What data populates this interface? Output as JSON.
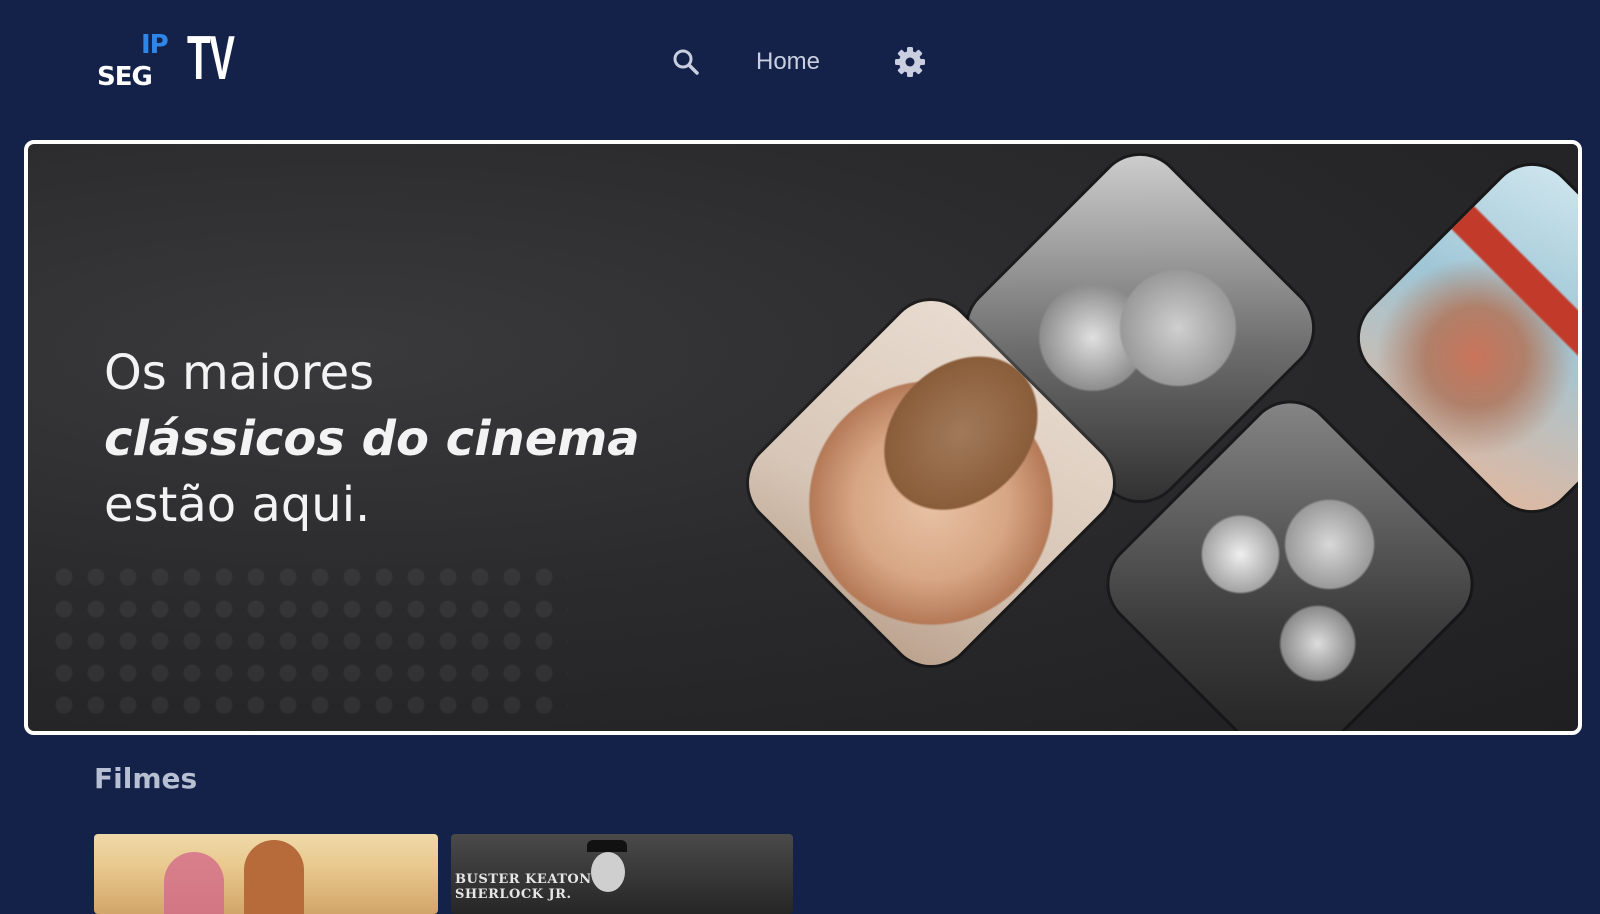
{
  "header": {
    "logo": {
      "ip": "IP",
      "seg": "SEG",
      "tv": "TV"
    },
    "nav": {
      "search_icon": "search-icon",
      "home_label": "Home",
      "settings_icon": "gear-icon"
    }
  },
  "hero": {
    "line1": "Os maiores",
    "line2": "clássicos do cinema",
    "line3": "estão aqui.",
    "images": [
      "cowboy-portrait-image",
      "noir-couple-image",
      "group-portrait-image",
      "giant-illustration-image"
    ]
  },
  "movies": {
    "section_title": "Filmes",
    "cards": [
      {
        "caption": ""
      },
      {
        "caption_line1": "BUSTER KEATON",
        "caption_line2": "SHERLOCK JR."
      }
    ]
  },
  "colors": {
    "background": "#14224a",
    "hero_border": "#ffffff",
    "logo_blue": "#2f86e8",
    "nav_text": "#c9cfe0"
  }
}
